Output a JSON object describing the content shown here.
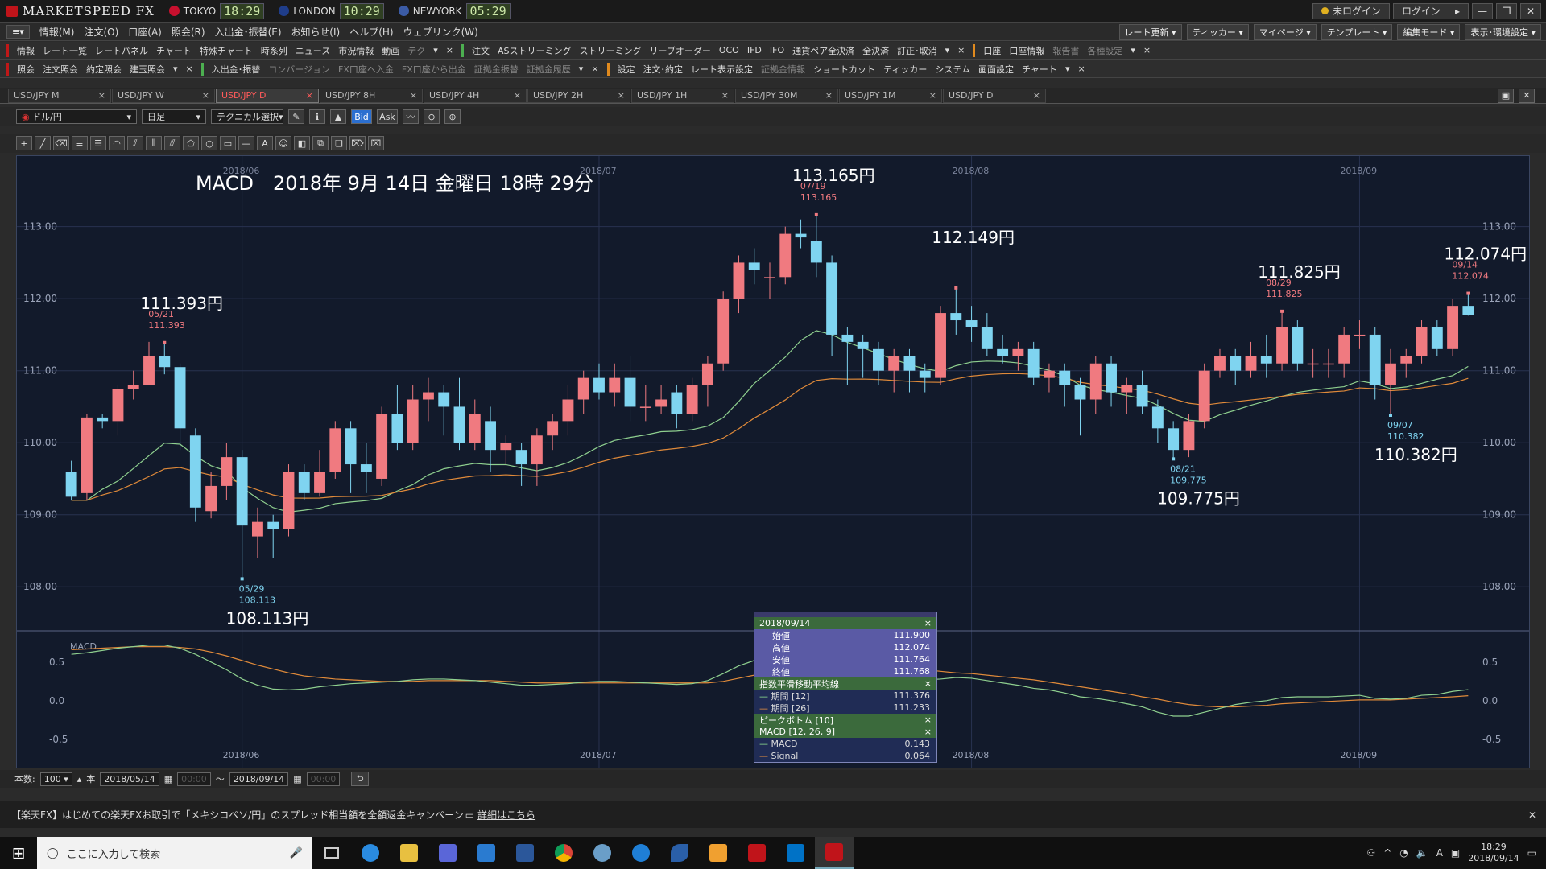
{
  "app": {
    "brand": "MARKETSPEED FX",
    "clocks": [
      {
        "city": "TOKYO",
        "time": "18:29",
        "color": "#c8102e"
      },
      {
        "city": "LONDON",
        "time": "10:29",
        "color": "#1f3d8a"
      },
      {
        "city": "NEWYORK",
        "time": "05:29",
        "color": "#3b5ba5"
      }
    ],
    "login_status": "未ログイン",
    "login_button": "ログイン"
  },
  "menu": {
    "items": [
      "情報(M)",
      "注文(O)",
      "口座(A)",
      "照会(R)",
      "入出金･振替(E)",
      "お知らせ(I)",
      "ヘルプ(H)",
      "ウェブリンク(W)"
    ],
    "right": [
      "レート更新",
      "ティッカー",
      "マイページ",
      "テンプレート",
      "編集モード",
      "表示･環境設定"
    ]
  },
  "row1": {
    "g1_label": "情報",
    "g1": [
      "レート一覧",
      "レートパネル",
      "チャート",
      "特殊チャート",
      "時系列",
      "ニュース",
      "市況情報",
      "動画",
      "テク"
    ],
    "g2_label": "注文",
    "g2": [
      "ASストリーミング",
      "ストリーミング",
      "リーブオーダー",
      "OCO",
      "IFD",
      "IFO",
      "通貨ペア全決済",
      "全決済",
      "訂正･取消"
    ],
    "g3_label": "口座",
    "g3": [
      "口座情報",
      "報告書",
      "各種設定"
    ]
  },
  "row2": {
    "g1_label": "照会",
    "g1": [
      "注文照会",
      "約定照会",
      "建玉照会"
    ],
    "g2_label": "入出金･振替",
    "g2": [
      "コンバージョン",
      "FX口座へ入金",
      "FX口座から出金",
      "証拠金振替",
      "証拠金履歴"
    ],
    "g3_label": "設定",
    "g3": [
      "注文･約定",
      "レート表示設定",
      "証拠金情報",
      "ショートカット",
      "ティッカー",
      "システム",
      "画面設定",
      "チャート"
    ]
  },
  "tabs": [
    "USD/JPY M",
    "USD/JPY W",
    "USD/JPY D",
    "USD/JPY 8H",
    "USD/JPY 4H",
    "USD/JPY 2H",
    "USD/JPY 1H",
    "USD/JPY 30M",
    "USD/JPY 1M",
    "USD/JPY D"
  ],
  "active_tab": 2,
  "chart_toolbar": {
    "pair": "ドル/円",
    "period": "日足",
    "technical": "テクニカル選択",
    "bid": "Bid",
    "ask": "Ask"
  },
  "info": {
    "date": "2018/09/14",
    "ohlc": [
      {
        "label": "始値",
        "value": "111.900"
      },
      {
        "label": "高値",
        "value": "112.074"
      },
      {
        "label": "安値",
        "value": "111.764"
      },
      {
        "label": "終値",
        "value": "111.768"
      }
    ],
    "ema_title": "指数平滑移動平均線",
    "ema": [
      {
        "label": "期間 [12]",
        "value": "111.376"
      },
      {
        "label": "期間 [26]",
        "value": "111.233"
      }
    ],
    "pb_title": "ピークボトム [10]",
    "macd_title": "MACD [12, 26, 9]",
    "macd": [
      {
        "label": "MACD",
        "value": "0.143"
      },
      {
        "label": "Signal",
        "value": "0.064"
      }
    ]
  },
  "bottom": {
    "count_label": "本数:",
    "count": "100",
    "unit": "本",
    "from": "2018/05/14",
    "time_from": "00:00",
    "tilde": "～",
    "to": "2018/09/14",
    "time_to": "00:00"
  },
  "ticker": {
    "text": "【楽天FX】はじめての楽天FXお取引で「メキシコペソ/円」のスプレッド相当額を全額返金キャンペーン",
    "link": "詳細はこちら"
  },
  "taskbar": {
    "search": "ここに入力して検索",
    "time": "18:29",
    "date": "2018/09/14"
  },
  "chart_data": {
    "type": "candlestick",
    "title": "MACD　2018年 9月 14日 金曜日 18時 29分",
    "y_ticks": [
      "113.00",
      "112.00",
      "111.00",
      "110.00",
      "109.00",
      "108.00"
    ],
    "ylim": [
      107.5,
      113.7
    ],
    "x_labels": [
      {
        "i": 11,
        "t": "2018/06"
      },
      {
        "i": 34,
        "t": "2018/07"
      },
      {
        "i": 58,
        "t": "2018/08"
      },
      {
        "i": 83,
        "t": "2018/09"
      }
    ],
    "candles": [
      [
        109.6,
        109.25,
        109.75,
        109.2
      ],
      [
        109.3,
        110.35,
        110.4,
        109.2
      ],
      [
        110.35,
        110.3,
        110.4,
        110.2
      ],
      [
        110.3,
        110.75,
        110.8,
        110.1
      ],
      [
        110.75,
        110.8,
        111.0,
        110.6
      ],
      [
        110.8,
        111.2,
        111.4,
        110.8
      ],
      [
        111.2,
        111.05,
        111.39,
        110.95
      ],
      [
        111.05,
        110.2,
        111.1,
        109.9
      ],
      [
        110.1,
        109.1,
        110.2,
        108.9
      ],
      [
        109.05,
        109.4,
        109.6,
        108.95
      ],
      [
        109.4,
        109.8,
        110.0,
        109.2
      ],
      [
        109.8,
        108.85,
        109.9,
        108.11
      ],
      [
        108.7,
        108.9,
        109.1,
        108.4
      ],
      [
        108.9,
        108.8,
        109.0,
        108.4
      ],
      [
        108.8,
        109.6,
        109.7,
        108.7
      ],
      [
        109.6,
        109.3,
        109.7,
        109.2
      ],
      [
        109.3,
        109.6,
        109.9,
        109.25
      ],
      [
        109.6,
        110.2,
        110.3,
        109.5
      ],
      [
        110.2,
        109.7,
        110.3,
        109.3
      ],
      [
        109.7,
        109.6,
        110.0,
        109.3
      ],
      [
        109.5,
        110.4,
        110.5,
        109.4
      ],
      [
        110.4,
        110.0,
        110.8,
        109.9
      ],
      [
        110.0,
        110.6,
        110.8,
        109.9
      ],
      [
        110.6,
        110.7,
        110.9,
        110.3
      ],
      [
        110.7,
        110.5,
        110.8,
        110.1
      ],
      [
        110.5,
        110.0,
        110.9,
        109.9
      ],
      [
        110.0,
        110.4,
        110.6,
        109.9
      ],
      [
        110.3,
        109.9,
        110.5,
        109.6
      ],
      [
        109.9,
        110.0,
        110.1,
        109.7
      ],
      [
        109.9,
        109.7,
        110.0,
        109.4
      ],
      [
        109.7,
        110.1,
        110.2,
        109.4
      ],
      [
        110.1,
        110.3,
        110.4,
        109.9
      ],
      [
        110.3,
        110.6,
        110.8,
        110.1
      ],
      [
        110.6,
        110.9,
        111.0,
        110.4
      ],
      [
        110.9,
        110.7,
        111.1,
        110.6
      ],
      [
        110.7,
        110.9,
        111.1,
        110.5
      ],
      [
        110.9,
        110.5,
        111.2,
        110.3
      ],
      [
        110.5,
        110.5,
        110.8,
        110.3
      ],
      [
        110.5,
        110.6,
        110.8,
        110.4
      ],
      [
        110.7,
        110.4,
        110.8,
        110.2
      ],
      [
        110.4,
        110.8,
        110.9,
        110.3
      ],
      [
        110.8,
        111.1,
        111.2,
        110.5
      ],
      [
        111.1,
        112.0,
        112.1,
        111.0
      ],
      [
        112.0,
        112.5,
        112.6,
        111.8
      ],
      [
        112.5,
        112.4,
        112.7,
        112.2
      ],
      [
        112.3,
        112.3,
        112.5,
        112.0
      ],
      [
        112.3,
        112.9,
        113.0,
        112.2
      ],
      [
        112.9,
        112.85,
        113.1,
        112.7
      ],
      [
        112.8,
        112.5,
        113.165,
        112.3
      ],
      [
        112.5,
        111.5,
        112.6,
        111.2
      ],
      [
        111.5,
        111.4,
        111.6,
        110.8
      ],
      [
        111.4,
        111.3,
        111.5,
        110.9
      ],
      [
        111.3,
        111.0,
        111.4,
        110.8
      ],
      [
        111.0,
        111.2,
        111.3,
        110.7
      ],
      [
        111.2,
        111.0,
        111.3,
        110.7
      ],
      [
        111.0,
        110.9,
        111.1,
        110.7
      ],
      [
        110.9,
        111.8,
        111.9,
        110.8
      ],
      [
        111.8,
        111.7,
        112.149,
        111.5
      ],
      [
        111.7,
        111.6,
        111.9,
        111.4
      ],
      [
        111.6,
        111.3,
        111.8,
        111.2
      ],
      [
        111.3,
        111.2,
        111.5,
        111.1
      ],
      [
        111.2,
        111.3,
        111.4,
        111.0
      ],
      [
        111.3,
        110.9,
        111.4,
        110.8
      ],
      [
        110.9,
        111.0,
        111.1,
        110.7
      ],
      [
        111.0,
        110.8,
        111.1,
        110.5
      ],
      [
        110.8,
        110.6,
        110.9,
        110.1
      ],
      [
        110.6,
        111.1,
        111.2,
        110.4
      ],
      [
        111.1,
        110.7,
        111.2,
        110.5
      ],
      [
        110.7,
        110.8,
        110.9,
        110.4
      ],
      [
        110.8,
        110.5,
        111.0,
        110.4
      ],
      [
        110.5,
        110.2,
        110.6,
        110.0
      ],
      [
        110.2,
        109.9,
        110.3,
        109.775
      ],
      [
        109.9,
        110.3,
        110.4,
        109.8
      ],
      [
        110.3,
        111.0,
        111.1,
        110.2
      ],
      [
        111.0,
        111.2,
        111.3,
        110.9
      ],
      [
        111.2,
        111.0,
        111.3,
        110.8
      ],
      [
        111.0,
        111.2,
        111.4,
        110.9
      ],
      [
        111.2,
        111.1,
        111.5,
        110.9
      ],
      [
        111.1,
        111.6,
        111.825,
        111.0
      ],
      [
        111.6,
        111.1,
        111.7,
        111.0
      ],
      [
        111.1,
        111.1,
        111.3,
        110.9
      ],
      [
        111.1,
        111.1,
        111.3,
        110.9
      ],
      [
        111.1,
        111.5,
        111.6,
        110.9
      ],
      [
        111.5,
        111.5,
        111.7,
        111.3
      ],
      [
        111.5,
        110.8,
        111.6,
        110.6
      ],
      [
        110.8,
        111.1,
        111.3,
        110.382
      ],
      [
        111.1,
        111.2,
        111.3,
        110.9
      ],
      [
        111.2,
        111.6,
        111.7,
        111.1
      ],
      [
        111.6,
        111.3,
        111.7,
        111.2
      ],
      [
        111.3,
        111.9,
        112.0,
        111.2
      ],
      [
        111.9,
        111.768,
        112.074,
        111.764
      ]
    ],
    "peaks": [
      {
        "i": 6,
        "price": "111.393円",
        "date": "05/21",
        "val": "111.393",
        "type": "high"
      },
      {
        "i": 11,
        "price": "108.113円",
        "date": "05/29",
        "val": "108.113",
        "type": "low"
      },
      {
        "i": 48,
        "price": "113.165円",
        "date": "07/19",
        "val": "113.165",
        "type": "high"
      },
      {
        "i": 57,
        "price": "112.149円",
        "date": "",
        "val": "",
        "type": "high"
      },
      {
        "i": 71,
        "price": "109.775円",
        "date": "08/21",
        "val": "109.775",
        "type": "low"
      },
      {
        "i": 78,
        "price": "111.825円",
        "date": "08/29",
        "val": "111.825",
        "type": "high"
      },
      {
        "i": 85,
        "price": "110.382円",
        "date": "09/07",
        "val": "110.382",
        "type": "low"
      },
      {
        "i": 90,
        "price": "112.074円",
        "date": "09/14",
        "val": "112.074",
        "type": "high"
      }
    ],
    "macd": {
      "label": "MACD",
      "ylim": [
        -0.7,
        0.8
      ],
      "y_ticks": [
        "0.5",
        "0.0",
        "-0.5"
      ],
      "macd": [
        0.6,
        0.62,
        0.65,
        0.68,
        0.7,
        0.72,
        0.72,
        0.68,
        0.6,
        0.5,
        0.4,
        0.28,
        0.2,
        0.15,
        0.14,
        0.15,
        0.18,
        0.2,
        0.22,
        0.23,
        0.24,
        0.25,
        0.27,
        0.28,
        0.28,
        0.27,
        0.26,
        0.24,
        0.22,
        0.2,
        0.2,
        0.21,
        0.22,
        0.24,
        0.25,
        0.25,
        0.24,
        0.23,
        0.22,
        0.21,
        0.22,
        0.26,
        0.35,
        0.45,
        0.52,
        0.57,
        0.63,
        0.68,
        0.7,
        0.62,
        0.52,
        0.45,
        0.38,
        0.34,
        0.3,
        0.27,
        0.28,
        0.3,
        0.29,
        0.26,
        0.23,
        0.2,
        0.16,
        0.14,
        0.1,
        0.05,
        0.03,
        0.0,
        -0.04,
        -0.08,
        -0.15,
        -0.2,
        -0.2,
        -0.15,
        -0.1,
        -0.05,
        -0.02,
        0.0,
        0.04,
        0.05,
        0.05,
        0.05,
        0.06,
        0.07,
        0.03,
        0.02,
        0.03,
        0.07,
        0.08,
        0.12,
        0.143
      ],
      "signal": [
        0.66,
        0.67,
        0.68,
        0.69,
        0.7,
        0.7,
        0.7,
        0.69,
        0.67,
        0.63,
        0.58,
        0.52,
        0.46,
        0.41,
        0.36,
        0.32,
        0.3,
        0.28,
        0.27,
        0.26,
        0.25,
        0.25,
        0.25,
        0.26,
        0.26,
        0.26,
        0.26,
        0.26,
        0.25,
        0.24,
        0.23,
        0.23,
        0.23,
        0.23,
        0.23,
        0.23,
        0.23,
        0.23,
        0.23,
        0.23,
        0.23,
        0.23,
        0.25,
        0.29,
        0.33,
        0.38,
        0.43,
        0.48,
        0.52,
        0.54,
        0.53,
        0.51,
        0.49,
        0.46,
        0.43,
        0.4,
        0.38,
        0.36,
        0.35,
        0.33,
        0.31,
        0.29,
        0.27,
        0.24,
        0.21,
        0.18,
        0.15,
        0.12,
        0.09,
        0.05,
        0.02,
        -0.02,
        -0.05,
        -0.07,
        -0.08,
        -0.08,
        -0.07,
        -0.06,
        -0.04,
        -0.03,
        -0.02,
        -0.01,
        0.0,
        0.01,
        0.01,
        0.01,
        0.02,
        0.03,
        0.04,
        0.05,
        0.064
      ]
    }
  }
}
